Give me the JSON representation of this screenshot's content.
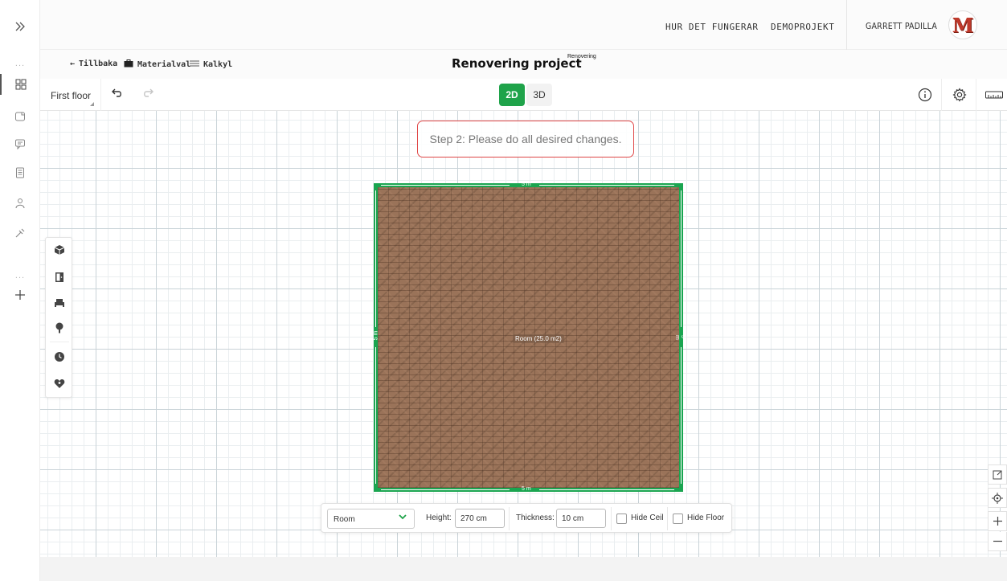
{
  "rail": {
    "items": [
      {
        "icon": "chevrons-right-icon"
      },
      {
        "icon": "layout-icon"
      },
      {
        "icon": "box-icon"
      },
      {
        "icon": "chat-icon"
      },
      {
        "icon": "document-icon"
      },
      {
        "icon": "user-icon"
      },
      {
        "icon": "paint-icon"
      },
      {
        "icon": "plus-icon"
      }
    ],
    "dots": "..."
  },
  "topbar": {
    "nav": [
      "HUR DET FUNGERAR",
      "DEMOPROJEKT"
    ],
    "user_name": "GARRETT PADILLA",
    "avatar_letter": "M"
  },
  "subheader": {
    "back": "Tillbaka",
    "materials": "Materialval",
    "calc": "Kalkyl",
    "title": "Renovering project",
    "tag": "Renovering"
  },
  "toolbar": {
    "floor": "First floor",
    "view_2d": "2D",
    "view_3d": "3D",
    "active_view": "2D"
  },
  "canvas": {
    "instruction": "Step 2: Please do all desired changes.",
    "room": {
      "label": "Room (25.0 m2)",
      "dims": {
        "top": "5 m",
        "bottom": "5 m",
        "left": "5 m",
        "right": "5 m"
      }
    }
  },
  "properties": {
    "type_value": "Room",
    "height_label": "Height:",
    "height_value": "270 cm",
    "thickness_label": "Thickness:",
    "thickness_value": "10 cm",
    "hide_ceil_label": "Hide Ceil",
    "hide_floor_label": "Hide Floor",
    "hide_ceil_checked": false,
    "hide_floor_checked": false
  },
  "colors": {
    "accent_green": "#1fa34a",
    "highlight_red": "#e04848"
  }
}
